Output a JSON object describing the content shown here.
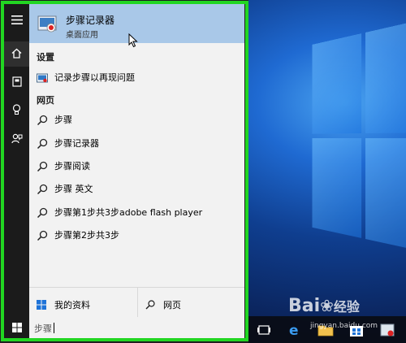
{
  "top_hit": {
    "title": "步骤记录器",
    "subtitle": "桌面应用"
  },
  "sections": {
    "settings": "设置",
    "web": "网页"
  },
  "settings_items": [
    {
      "label": "记录步骤以再现问题",
      "icon": "settings-app-icon"
    }
  ],
  "web_items": [
    {
      "label": "步骤",
      "icon": "search-icon"
    },
    {
      "label": "步骤记录器",
      "icon": "search-icon"
    },
    {
      "label": "步骤阅读",
      "icon": "search-icon"
    },
    {
      "label": "步骤 英文",
      "icon": "search-icon"
    },
    {
      "label": "步骤第1步共3步adobe flash player",
      "icon": "search-icon"
    },
    {
      "label": "步骤第2步共3步",
      "icon": "search-icon"
    }
  ],
  "bottom": {
    "my_stuff": "我的资料",
    "web": "网页"
  },
  "search": {
    "value": "步骤"
  },
  "watermark": {
    "brand": "Bai",
    "brand2": "经验",
    "url": "jingyan.baidu.com"
  },
  "colors": {
    "frame": "#22d622",
    "top_hit_bg": "#a9c8e8",
    "panel_bg": "#f2f2f2",
    "rail_bg": "#1b1b1b"
  }
}
